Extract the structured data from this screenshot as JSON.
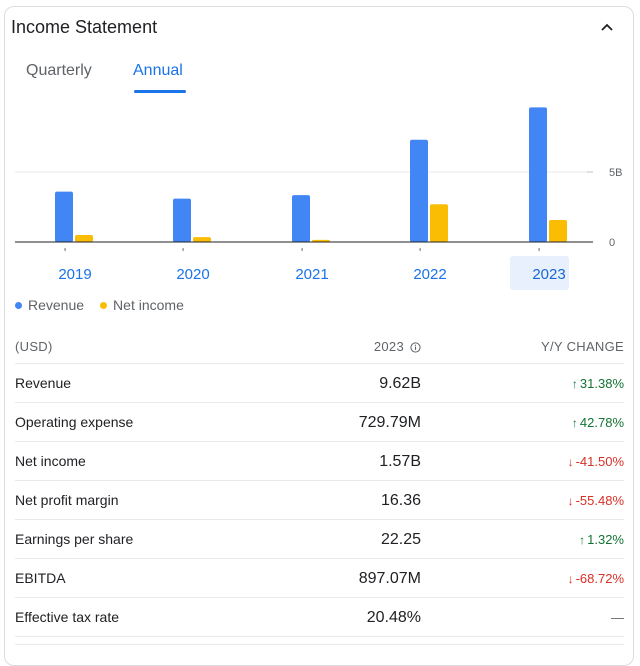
{
  "card": {
    "title": "Income Statement",
    "collapse_icon": "chevron-up-icon"
  },
  "tabs": [
    {
      "label": "Quarterly",
      "active": false
    },
    {
      "label": "Annual",
      "active": true
    }
  ],
  "colors": {
    "revenue": "#4285f4",
    "net_income": "#fbbc04",
    "accent": "#1a73e8",
    "selected_year_bg": "#e8f0fe",
    "positive": "#137333",
    "negative": "#d93025"
  },
  "chart_data": {
    "type": "bar",
    "categories": [
      "2019",
      "2020",
      "2021",
      "2022",
      "2023"
    ],
    "selected_category": "2023",
    "series": [
      {
        "name": "Revenue",
        "values": [
          3.6,
          3.1,
          3.35,
          7.3,
          9.62
        ]
      },
      {
        "name": "Net income",
        "values": [
          0.5,
          0.35,
          0.15,
          2.7,
          1.57
        ]
      }
    ],
    "unit": "B USD",
    "y_ticks": [
      {
        "value": 0,
        "label": "0"
      },
      {
        "value": 5,
        "label": "5B"
      }
    ],
    "ylim": [
      0,
      10
    ],
    "grid": true,
    "y_axis_position": "right",
    "legend_position": "bottom-left",
    "title": "",
    "xlabel": "",
    "ylabel": ""
  },
  "legend": [
    {
      "label": "Revenue"
    },
    {
      "label": "Net income"
    }
  ],
  "table": {
    "header": {
      "currency": "(USD)",
      "year": "2023",
      "change": "Y/Y CHANGE"
    },
    "rows": [
      {
        "label": "Revenue",
        "value": "9.62B",
        "change": "31.38%",
        "direction": "up",
        "arrow": "↑"
      },
      {
        "label": "Operating expense",
        "value": "729.79M",
        "change": "42.78%",
        "direction": "up",
        "arrow": "↑"
      },
      {
        "label": "Net income",
        "value": "1.57B",
        "change": "-41.50%",
        "direction": "down",
        "arrow": "↓"
      },
      {
        "label": "Net profit margin",
        "value": "16.36",
        "change": "-55.48%",
        "direction": "down",
        "arrow": "↓"
      },
      {
        "label": "Earnings per share",
        "value": "22.25",
        "change": "1.32%",
        "direction": "up",
        "arrow": "↑"
      },
      {
        "label": "EBITDA",
        "value": "897.07M",
        "change": "-68.72%",
        "direction": "down",
        "arrow": "↓"
      },
      {
        "label": "Effective tax rate",
        "value": "20.48%",
        "change": "—",
        "direction": "flat",
        "arrow": ""
      }
    ]
  }
}
